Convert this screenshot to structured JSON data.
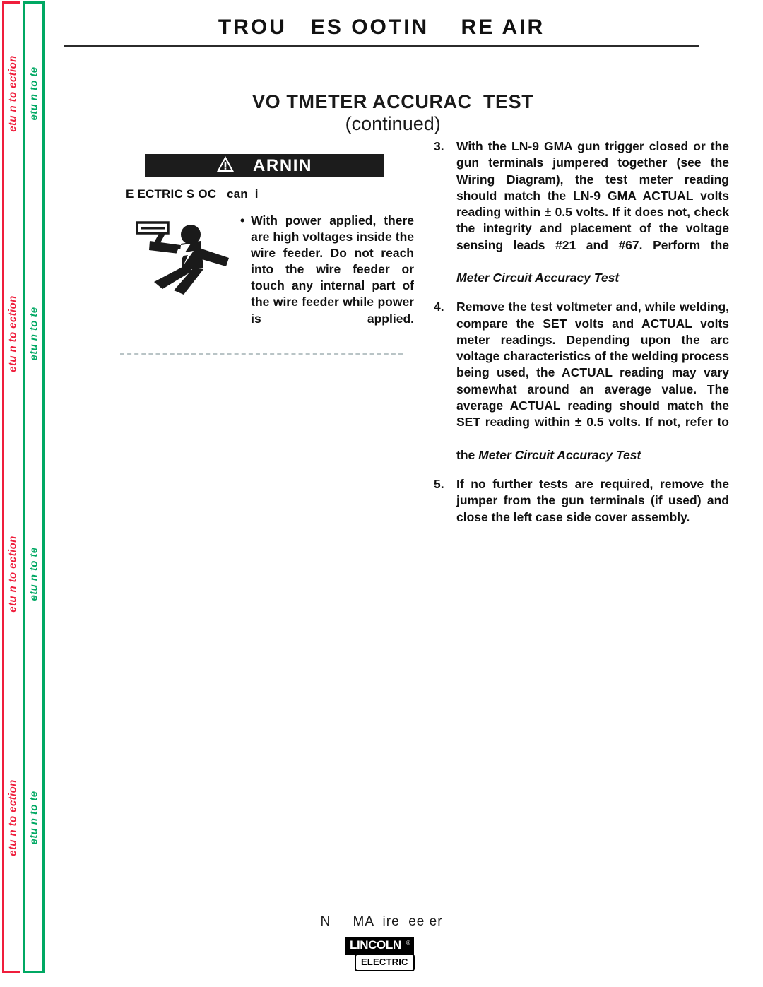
{
  "page": {
    "header_title": "TROU   ES OOTIN    RE AIR",
    "section_subtitle": "VO TMETER ACCURAC  TEST",
    "section_subtitle_continued": "(continued)"
  },
  "side_tabs": {
    "red_label": "etu n to   ection",
    "green_label": "etu n to    te",
    "red_color": "#ef1e3c",
    "green_color": "#00a863",
    "repeat_count": 4
  },
  "warning": {
    "bar_label": "ARNIN",
    "bar_color": "#1c1c1c",
    "triangle_icon": "warning-triangle-icon",
    "lead_text": "E ECTRIC S OC   can  i",
    "figure_icon": "electric-shock-figure-icon",
    "bullet_marker": "•",
    "bullet_text": "With power applied, there are high voltages inside the wire feeder.  Do not reach into the wire feeder or touch any internal part of the wire feeder while power is applied."
  },
  "steps": [
    {
      "number": "3.",
      "text": "With the LN-9 GMA gun trigger closed or the gun terminals jumpered together (see the Wiring Diagram), the test meter reading should match the LN-9 GMA ACTUAL  volts reading within ± 0.5 volts.  If it does not, check the integrity and placement of the voltage sensing leads #21 and #67.   Perform the",
      "italic_tail": "Meter Circuit Accuracy Test",
      "tail_prefix": ""
    },
    {
      "number": "4.",
      "text": "Remove the test voltmeter and, while welding, compare the SET volts and ACTUAL volts meter readings.  Depending upon the arc voltage characteristics of the welding process being used, the ACTUAL reading may vary somewhat around an average value.  The average ACTUAL reading should match the SET reading within ± 0.5 volts.  If not, refer to",
      "italic_tail": "Meter Circuit Accuracy Test",
      "tail_prefix": "the "
    },
    {
      "number": "5.",
      "text": "If no further tests are required, remove the jumper from the gun terminals (if used) and close the left case side cover assembly.",
      "italic_tail": "",
      "tail_prefix": ""
    }
  ],
  "footer": {
    "model_text": "N     MA  ire  ee er",
    "logo_primary": "LINCOLN",
    "logo_registered": "®",
    "logo_secondary": "ELECTRIC"
  }
}
